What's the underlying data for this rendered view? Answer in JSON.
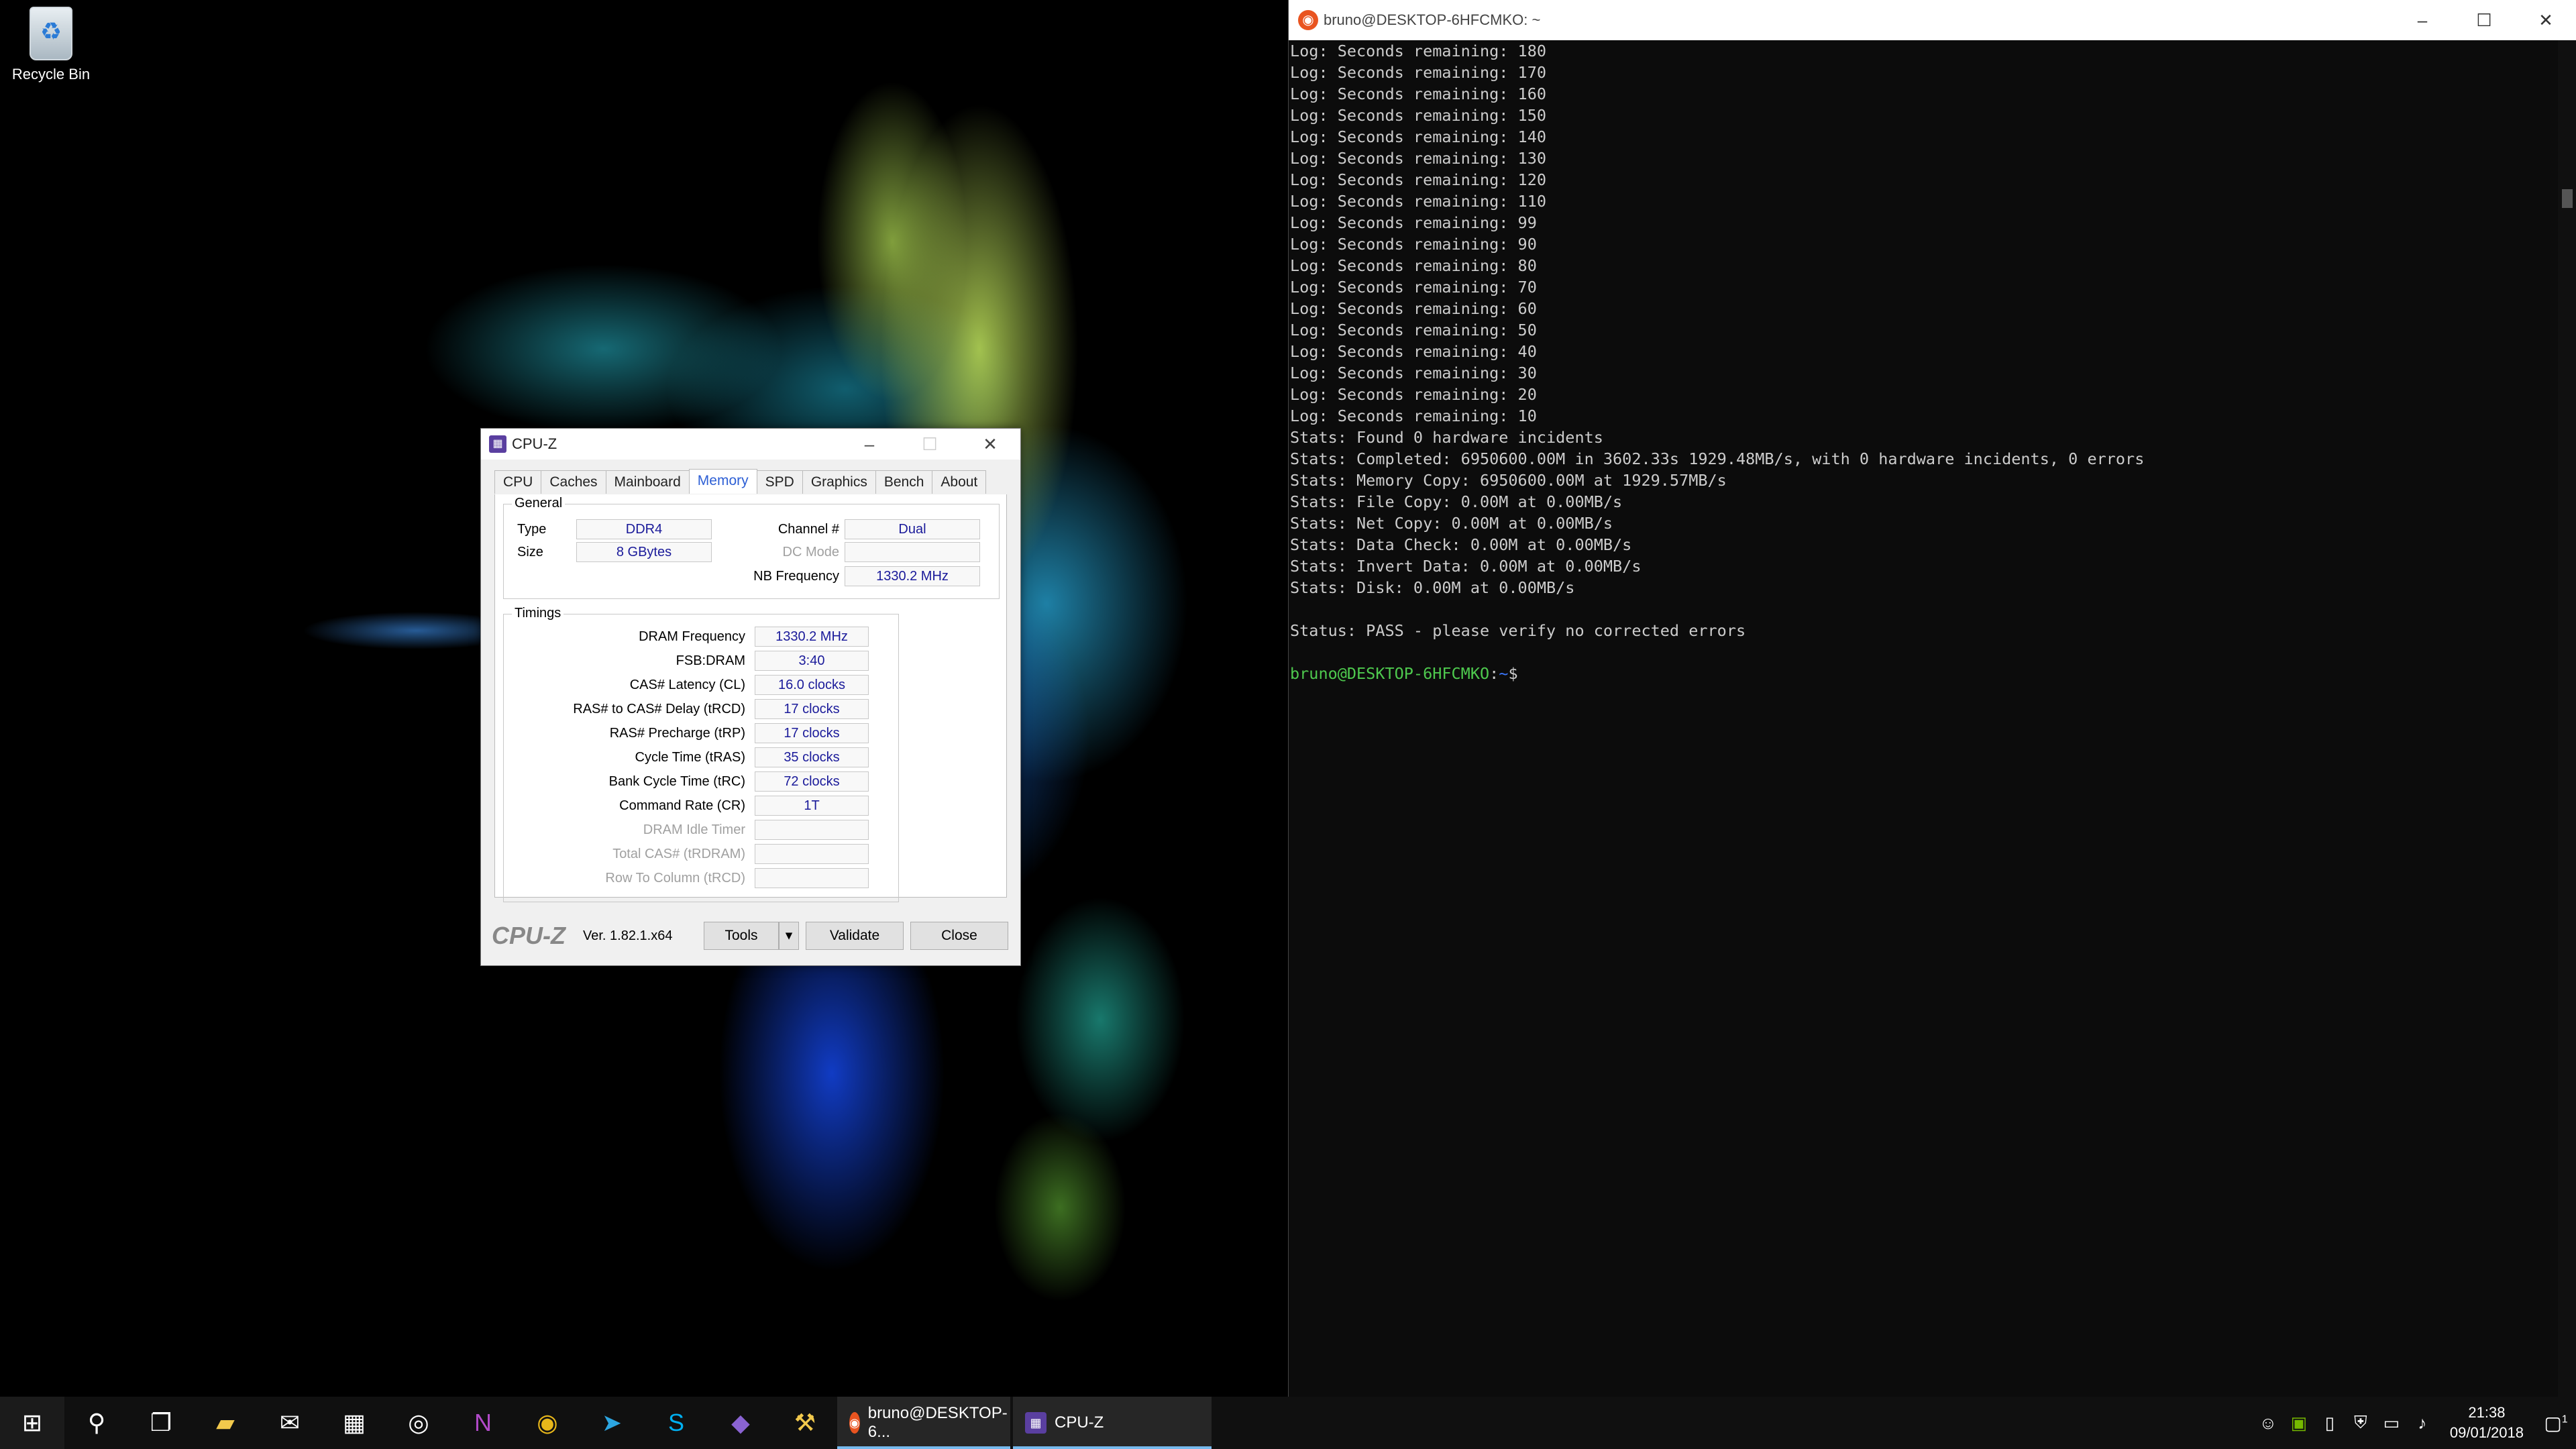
{
  "desktop": {
    "recycle_bin_label": "Recycle Bin"
  },
  "cpuz": {
    "title": "CPU-Z",
    "tabs": [
      "CPU",
      "Caches",
      "Mainboard",
      "Memory",
      "SPD",
      "Graphics",
      "Bench",
      "About"
    ],
    "active_tab": "Memory",
    "general": {
      "title": "General",
      "type_label": "Type",
      "type_value": "DDR4",
      "size_label": "Size",
      "size_value": "8 GBytes",
      "channel_label": "Channel #",
      "channel_value": "Dual",
      "dc_mode_label": "DC Mode",
      "dc_mode_value": "",
      "nb_freq_label": "NB Frequency",
      "nb_freq_value": "1330.2 MHz"
    },
    "timings": {
      "title": "Timings",
      "rows": [
        {
          "label": "DRAM Frequency",
          "value": "1330.2 MHz",
          "dim": false
        },
        {
          "label": "FSB:DRAM",
          "value": "3:40",
          "dim": false
        },
        {
          "label": "CAS# Latency (CL)",
          "value": "16.0 clocks",
          "dim": false
        },
        {
          "label": "RAS# to CAS# Delay (tRCD)",
          "value": "17 clocks",
          "dim": false
        },
        {
          "label": "RAS# Precharge (tRP)",
          "value": "17 clocks",
          "dim": false
        },
        {
          "label": "Cycle Time (tRAS)",
          "value": "35 clocks",
          "dim": false
        },
        {
          "label": "Bank Cycle Time (tRC)",
          "value": "72 clocks",
          "dim": false
        },
        {
          "label": "Command Rate (CR)",
          "value": "1T",
          "dim": false
        },
        {
          "label": "DRAM Idle Timer",
          "value": "",
          "dim": true
        },
        {
          "label": "Total CAS# (tRDRAM)",
          "value": "",
          "dim": true
        },
        {
          "label": "Row To Column (tRCD)",
          "value": "",
          "dim": true
        }
      ]
    },
    "footer": {
      "logo": "CPU-Z",
      "version": "Ver. 1.82.1.x64",
      "tools_label": "Tools",
      "validate_label": "Validate",
      "close_label": "Close"
    }
  },
  "terminal": {
    "title": "bruno@DESKTOP-6HFCMKO: ~",
    "lines": [
      "Log: Seconds remaining: 180",
      "Log: Seconds remaining: 170",
      "Log: Seconds remaining: 160",
      "Log: Seconds remaining: 150",
      "Log: Seconds remaining: 140",
      "Log: Seconds remaining: 130",
      "Log: Seconds remaining: 120",
      "Log: Seconds remaining: 110",
      "Log: Seconds remaining: 99",
      "Log: Seconds remaining: 90",
      "Log: Seconds remaining: 80",
      "Log: Seconds remaining: 70",
      "Log: Seconds remaining: 60",
      "Log: Seconds remaining: 50",
      "Log: Seconds remaining: 40",
      "Log: Seconds remaining: 30",
      "Log: Seconds remaining: 20",
      "Log: Seconds remaining: 10",
      "Stats: Found 0 hardware incidents",
      "Stats: Completed: 6950600.00M in 3602.33s 1929.48MB/s, with 0 hardware incidents, 0 errors",
      "Stats: Memory Copy: 6950600.00M at 1929.57MB/s",
      "Stats: File Copy: 0.00M at 0.00MB/s",
      "Stats: Net Copy: 0.00M at 0.00MB/s",
      "Stats: Data Check: 0.00M at 0.00MB/s",
      "Stats: Invert Data: 0.00M at 0.00MB/s",
      "Stats: Disk: 0.00M at 0.00MB/s",
      "",
      "Status: PASS - please verify no corrected errors",
      ""
    ],
    "prompt_user": "bruno@DESKTOP-6HFCMKO",
    "prompt_sep": ":",
    "prompt_path": "~",
    "prompt_symbol": "$"
  },
  "taskbar": {
    "pinned_icons": [
      "windows-start-icon",
      "search-icon",
      "task-view-icon",
      "file-explorer-icon",
      "mail-icon",
      "calendar-icon",
      "groove-music-icon",
      "onenote-icon",
      "chrome-icon",
      "telegram-icon",
      "skype-icon",
      "visual-studio-icon",
      "tool-app-icon"
    ],
    "apps": [
      {
        "label": "bruno@DESKTOP-6...",
        "icon": "ubuntu-icon"
      },
      {
        "label": "CPU-Z",
        "icon": "cpuz-icon"
      }
    ],
    "clock_time": "21:38",
    "clock_date": "09/01/2018",
    "notification_count": "1"
  }
}
